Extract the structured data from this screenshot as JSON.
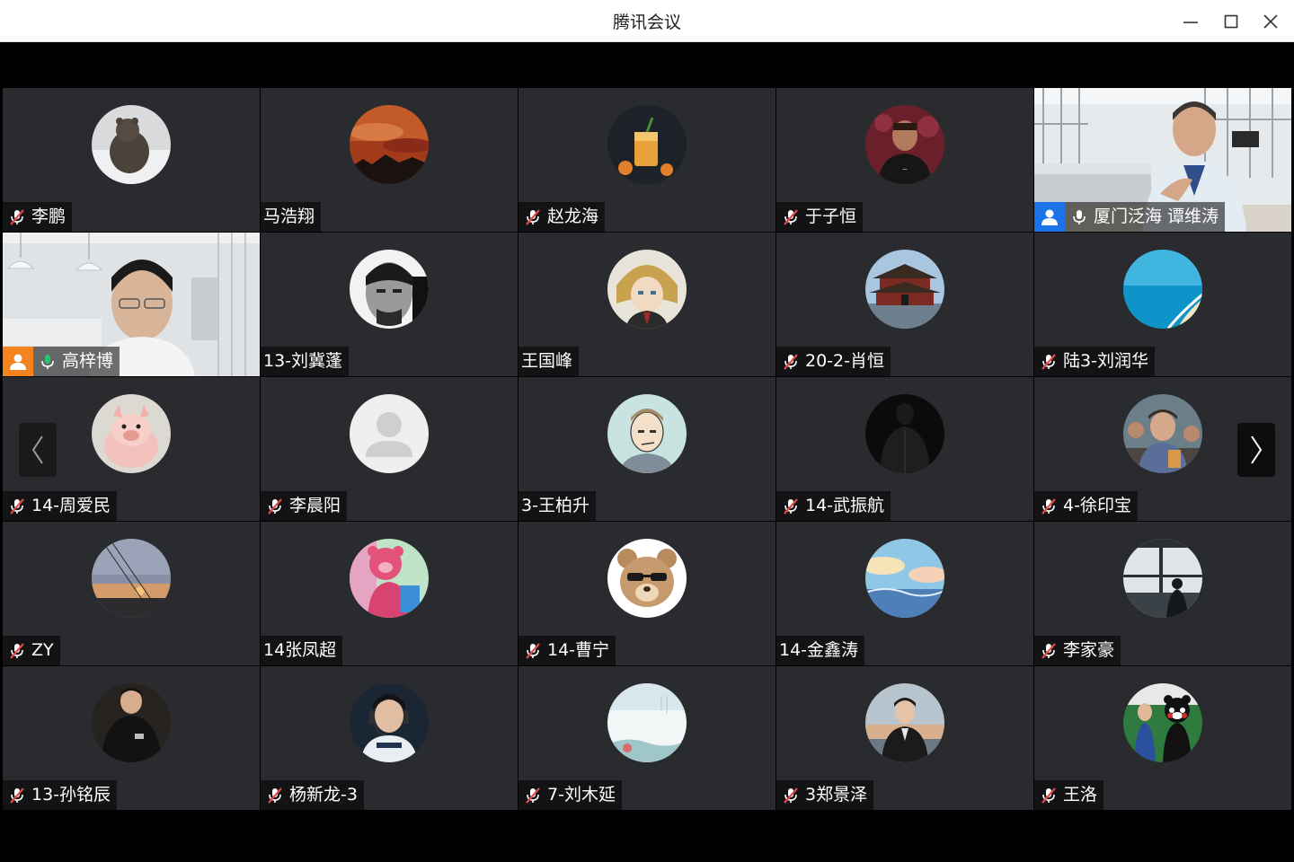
{
  "window": {
    "title": "腾讯会议"
  },
  "colors": {
    "tile_bg": "#2a2b2f",
    "active_border": "#29c36a",
    "host_blue": "#1a73e8",
    "host_orange": "#f5841f",
    "mute_red": "#e24b4b"
  },
  "participants": [
    {
      "name": "李鹏",
      "muted": true,
      "avatar": "bear-photo"
    },
    {
      "name": "马浩翔",
      "muted": false,
      "avatar": "sunset-clouds"
    },
    {
      "name": "赵龙海",
      "muted": true,
      "avatar": "cocktail"
    },
    {
      "name": "于子恒",
      "muted": true,
      "avatar": "basketball-player"
    },
    {
      "name": "厦门泛海 谭维涛",
      "muted": false,
      "avatar": "video-office",
      "host": "blue"
    },
    {
      "name": "高梓博",
      "muted": false,
      "avatar": "video-room",
      "host": "orange",
      "speaking": true
    },
    {
      "name": "13-刘冀蓬",
      "muted": false,
      "avatar": "bw-portrait"
    },
    {
      "name": "王国峰",
      "muted": false,
      "avatar": "anime-character"
    },
    {
      "name": "20-2-肖恒",
      "muted": true,
      "avatar": "temple"
    },
    {
      "name": "陆3-刘润华",
      "muted": true,
      "avatar": "beach-aerial"
    },
    {
      "name": "14-周爱民",
      "muted": true,
      "avatar": "piglet"
    },
    {
      "name": "李晨阳",
      "muted": true,
      "avatar": "default-user"
    },
    {
      "name": "3-王柏升",
      "muted": false,
      "avatar": "cartoon-man"
    },
    {
      "name": "14-武振航",
      "muted": true,
      "avatar": "dark-figure"
    },
    {
      "name": "4-徐印宝",
      "muted": true,
      "avatar": "group-photo"
    },
    {
      "name": "ZY",
      "muted": true,
      "avatar": "dusk-sky"
    },
    {
      "name": "14张凤超",
      "muted": false,
      "avatar": "pink-bear-cartoon"
    },
    {
      "name": "14-曹宁",
      "muted": true,
      "avatar": "teddy-bear"
    },
    {
      "name": "14-金鑫涛",
      "muted": false,
      "avatar": "pastel-sky"
    },
    {
      "name": "李家豪",
      "muted": true,
      "avatar": "window-silhouette"
    },
    {
      "name": "13-孙铭辰",
      "muted": true,
      "avatar": "man-black-shirt"
    },
    {
      "name": "杨新龙-3",
      "muted": true,
      "avatar": "gamer-headset"
    },
    {
      "name": "7-刘木延",
      "muted": true,
      "avatar": "watercolor"
    },
    {
      "name": "3郑景泽",
      "muted": true,
      "avatar": "man-seaside"
    },
    {
      "name": "王洛",
      "muted": true,
      "avatar": "kumamon"
    }
  ]
}
